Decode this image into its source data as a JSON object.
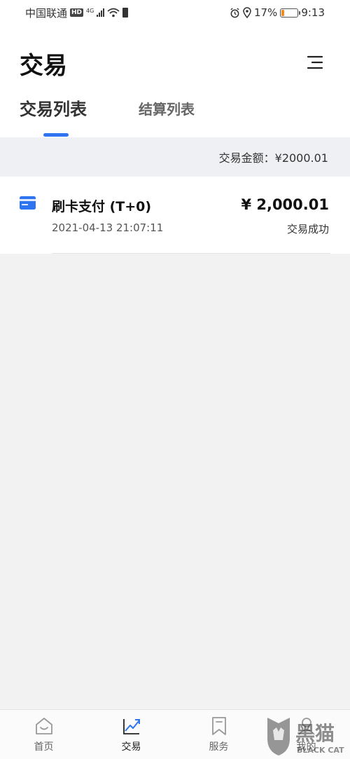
{
  "status_bar": {
    "carrier": "中国联通",
    "hd": "HD",
    "net_type": "4G",
    "battery_percent": "17%",
    "battery_level": 0.17,
    "time": "9:13"
  },
  "header": {
    "title": "交易",
    "tabs": [
      {
        "label": "交易列表",
        "active": true
      },
      {
        "label": "结算列表",
        "active": false
      }
    ]
  },
  "summary": {
    "text": "交易金额：¥2000.01"
  },
  "transactions": [
    {
      "title": "刷卡支付 (T+0)",
      "time": "2021-04-13 21:07:11",
      "amount": "¥ 2,000.01",
      "status": "交易成功",
      "icon": "card-icon"
    }
  ],
  "bottom_nav": {
    "items": [
      {
        "label": "首页",
        "icon": "home-icon",
        "active": false
      },
      {
        "label": "交易",
        "icon": "trade-chart-icon",
        "active": true
      },
      {
        "label": "服务",
        "icon": "bookmark-icon",
        "active": false
      },
      {
        "label": "我的",
        "icon": "profile-icon",
        "active": false
      }
    ]
  },
  "watermark": {
    "logo_text": "黑猫",
    "sub_text": "BLACK CAT"
  },
  "colors": {
    "accent": "#2e74f0",
    "background": "#f2f2f3",
    "summary_bg": "#eef0f3"
  }
}
